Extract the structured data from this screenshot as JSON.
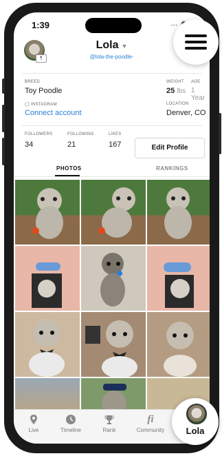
{
  "status": {
    "time": "1:39",
    "icons": "… ◉ ▭"
  },
  "header": {
    "name": "Lola",
    "caret": "▼",
    "handle": "@lola-the-poodle-",
    "avatar_badge": "¶"
  },
  "profile": {
    "breed_label": "BREED",
    "breed": "Toy Poodle",
    "weight_label": "WEIGHT",
    "weight_value": "25",
    "weight_unit": "lbs",
    "age_label": "AGE",
    "age_value": "1 Year",
    "instagram_label": "INSTAGRAM",
    "instagram_link": "Connect account",
    "location_label": "LOCATION",
    "location": "Denver, CO",
    "followers_label": "FOLLOWERS",
    "followers": "34",
    "following_label": "FOLLOWING",
    "following": "21",
    "likes_label": "LIKES",
    "likes": "167",
    "edit_button": "Edit Profile"
  },
  "tabs": [
    {
      "label": "PHOTOS",
      "active": true
    },
    {
      "label": "RANKINGS",
      "active": false
    }
  ],
  "nav": [
    {
      "label": "Live",
      "icon": "location-pin-icon"
    },
    {
      "label": "Timeline",
      "icon": "clock-icon"
    },
    {
      "label": "Rank",
      "icon": "trophy-icon"
    },
    {
      "label": "Community",
      "icon": "fi-icon",
      "glyph": "fi"
    },
    {
      "label": "Lola",
      "icon": "profile-avatar"
    }
  ],
  "colors": {
    "link": "#2b7fd6",
    "phone_frame": "#1a1a1a",
    "nav_bg": "#f5f5f5"
  }
}
